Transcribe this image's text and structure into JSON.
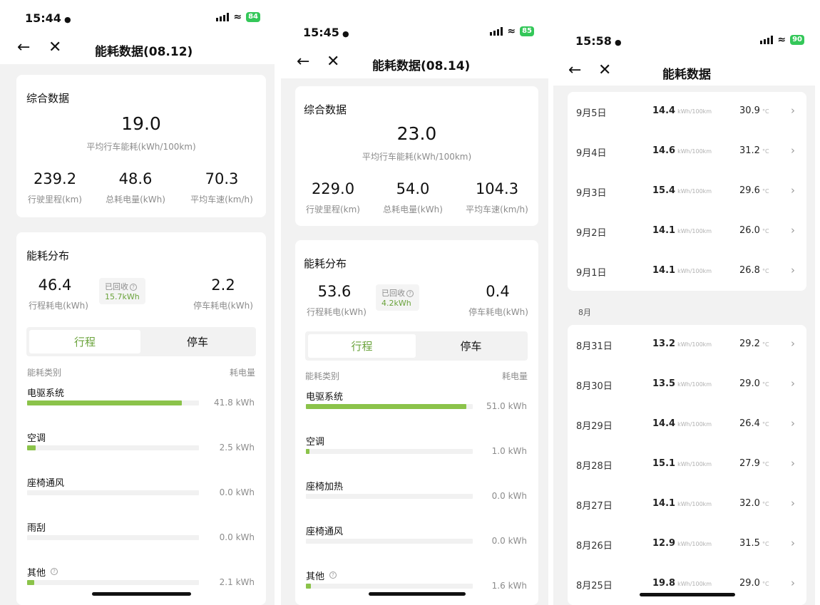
{
  "screens": [
    {
      "status": {
        "time": "15:44",
        "battery": "84"
      },
      "title": "能耗数据(08.12)",
      "summary": {
        "card_title": "综合数据",
        "avg_value": "19.0",
        "avg_label": "平均行车能耗(kWh/100km)",
        "stats": [
          {
            "value": "239.2",
            "label": "行驶里程(km)"
          },
          {
            "value": "48.6",
            "label": "总耗电量(kWh)"
          },
          {
            "value": "70.3",
            "label": "平均车速(km/h)"
          }
        ]
      },
      "dist": {
        "card_title": "能耗分布",
        "drive_value": "46.4",
        "drive_label": "行程耗电(kWh)",
        "recovered_label": "已回收",
        "recovered_value": "15.7kWh",
        "park_value": "2.2",
        "park_label": "停车耗电(kWh)",
        "tab_trip": "行程",
        "tab_park": "停车",
        "col_category": "能耗类别",
        "col_usage": "耗电量",
        "items": [
          {
            "name": "电驱系统",
            "value": "41.8 kWh",
            "fill": 0.9
          },
          {
            "name": "空调",
            "value": "2.5 kWh",
            "fill": 0.05
          },
          {
            "name": "座椅通风",
            "value": "0.0 kWh",
            "fill": 0
          },
          {
            "name": "雨刮",
            "value": "0.0 kWh",
            "fill": 0
          },
          {
            "name": "其他",
            "value": "2.1 kWh",
            "fill": 0.04,
            "help": true
          }
        ]
      }
    },
    {
      "status": {
        "time": "15:45",
        "battery": "85"
      },
      "title": "能耗数据(08.14)",
      "summary": {
        "card_title": "综合数据",
        "avg_value": "23.0",
        "avg_label": "平均行车能耗(kWh/100km)",
        "stats": [
          {
            "value": "229.0",
            "label": "行驶里程(km)"
          },
          {
            "value": "54.0",
            "label": "总耗电量(kWh)"
          },
          {
            "value": "104.3",
            "label": "平均车速(km/h)"
          }
        ]
      },
      "dist": {
        "card_title": "能耗分布",
        "drive_value": "53.6",
        "drive_label": "行程耗电(kWh)",
        "recovered_label": "已回收",
        "recovered_value": "4.2kWh",
        "park_value": "0.4",
        "park_label": "停车耗电(kWh)",
        "tab_trip": "行程",
        "tab_park": "停车",
        "col_category": "能耗类别",
        "col_usage": "耗电量",
        "items": [
          {
            "name": "电驱系统",
            "value": "51.0 kWh",
            "fill": 0.96
          },
          {
            "name": "空调",
            "value": "1.0 kWh",
            "fill": 0.02
          },
          {
            "name": "座椅加热",
            "value": "0.0 kWh",
            "fill": 0
          },
          {
            "name": "座椅通风",
            "value": "0.0 kWh",
            "fill": 0
          },
          {
            "name": "其他",
            "value": "1.6 kWh",
            "fill": 0.03,
            "help": true
          }
        ]
      }
    },
    {
      "status": {
        "time": "15:58",
        "battery": "90"
      },
      "title": "能耗数据",
      "consumption_unit": "kWh/100km",
      "temp_unit": "°C",
      "september": [
        {
          "date": "9月5日",
          "consumption": "14.4",
          "temp": "30.9"
        },
        {
          "date": "9月4日",
          "consumption": "14.6",
          "temp": "31.2"
        },
        {
          "date": "9月3日",
          "consumption": "15.4",
          "temp": "29.6"
        },
        {
          "date": "9月2日",
          "consumption": "14.1",
          "temp": "26.0"
        },
        {
          "date": "9月1日",
          "consumption": "14.1",
          "temp": "26.8"
        }
      ],
      "august_label": "8月",
      "august": [
        {
          "date": "8月31日",
          "consumption": "13.2",
          "temp": "29.2"
        },
        {
          "date": "8月30日",
          "consumption": "13.5",
          "temp": "29.0"
        },
        {
          "date": "8月29日",
          "consumption": "14.4",
          "temp": "26.4"
        },
        {
          "date": "8月28日",
          "consumption": "15.1",
          "temp": "27.9"
        },
        {
          "date": "8月27日",
          "consumption": "14.1",
          "temp": "32.0"
        },
        {
          "date": "8月26日",
          "consumption": "12.9",
          "temp": "31.5"
        },
        {
          "date": "8月25日",
          "consumption": "19.8",
          "temp": "29.0"
        }
      ]
    }
  ],
  "colors": {
    "accent": "#6aa33b",
    "bar": "#8bc34a",
    "battery": "#34c759"
  }
}
